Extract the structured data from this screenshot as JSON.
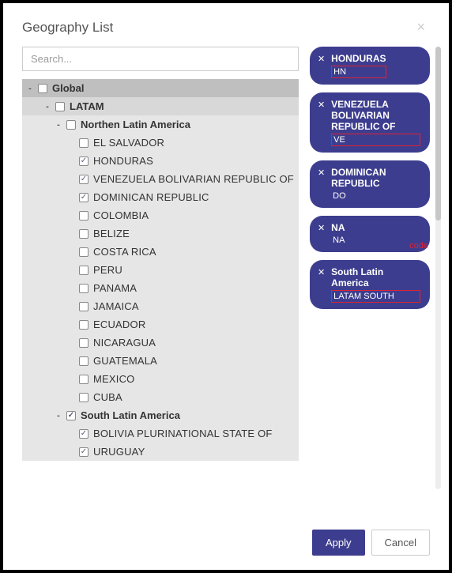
{
  "header": {
    "title": "Geography List"
  },
  "search": {
    "placeholder": "Search..."
  },
  "tree": {
    "lvl0": {
      "label": "Global",
      "checked": false
    },
    "lvl1": {
      "label": "LATAM",
      "checked": false
    },
    "groups": [
      {
        "label": "Northen Latin America",
        "checked": false,
        "items": [
          {
            "label": "EL SALVADOR",
            "checked": false
          },
          {
            "label": "HONDURAS",
            "checked": true
          },
          {
            "label": "VENEZUELA BOLIVARIAN REPUBLIC OF",
            "checked": true
          },
          {
            "label": "DOMINICAN REPUBLIC",
            "checked": true
          },
          {
            "label": "COLOMBIA",
            "checked": false
          },
          {
            "label": "BELIZE",
            "checked": false
          },
          {
            "label": "COSTA RICA",
            "checked": false
          },
          {
            "label": "PERU",
            "checked": false
          },
          {
            "label": "PANAMA",
            "checked": false
          },
          {
            "label": "JAMAICA",
            "checked": false
          },
          {
            "label": "ECUADOR",
            "checked": false
          },
          {
            "label": "NICARAGUA",
            "checked": false
          },
          {
            "label": "GUATEMALA",
            "checked": false
          },
          {
            "label": "MEXICO",
            "checked": false
          },
          {
            "label": "CUBA",
            "checked": false
          }
        ]
      },
      {
        "label": "South Latin America",
        "checked": true,
        "items": [
          {
            "label": "BOLIVIA PLURINATIONAL STATE OF",
            "checked": true
          },
          {
            "label": "URUGUAY",
            "checked": true
          }
        ]
      }
    ]
  },
  "chips": [
    {
      "name": "HONDURAS",
      "code": "HN",
      "highlight": true
    },
    {
      "name": "VENEZUELA BOLIVARIAN REPUBLIC OF",
      "code": "VE",
      "highlight": true
    },
    {
      "name": "DOMINICAN REPUBLIC",
      "code": "DO",
      "highlight": false
    },
    {
      "name": "NA",
      "code": "NA",
      "highlight": false
    },
    {
      "name": "South Latin America",
      "code": "LATAM SOUTH",
      "highlight": true
    }
  ],
  "annot": "code",
  "footer": {
    "apply": "Apply",
    "cancel": "Cancel"
  }
}
